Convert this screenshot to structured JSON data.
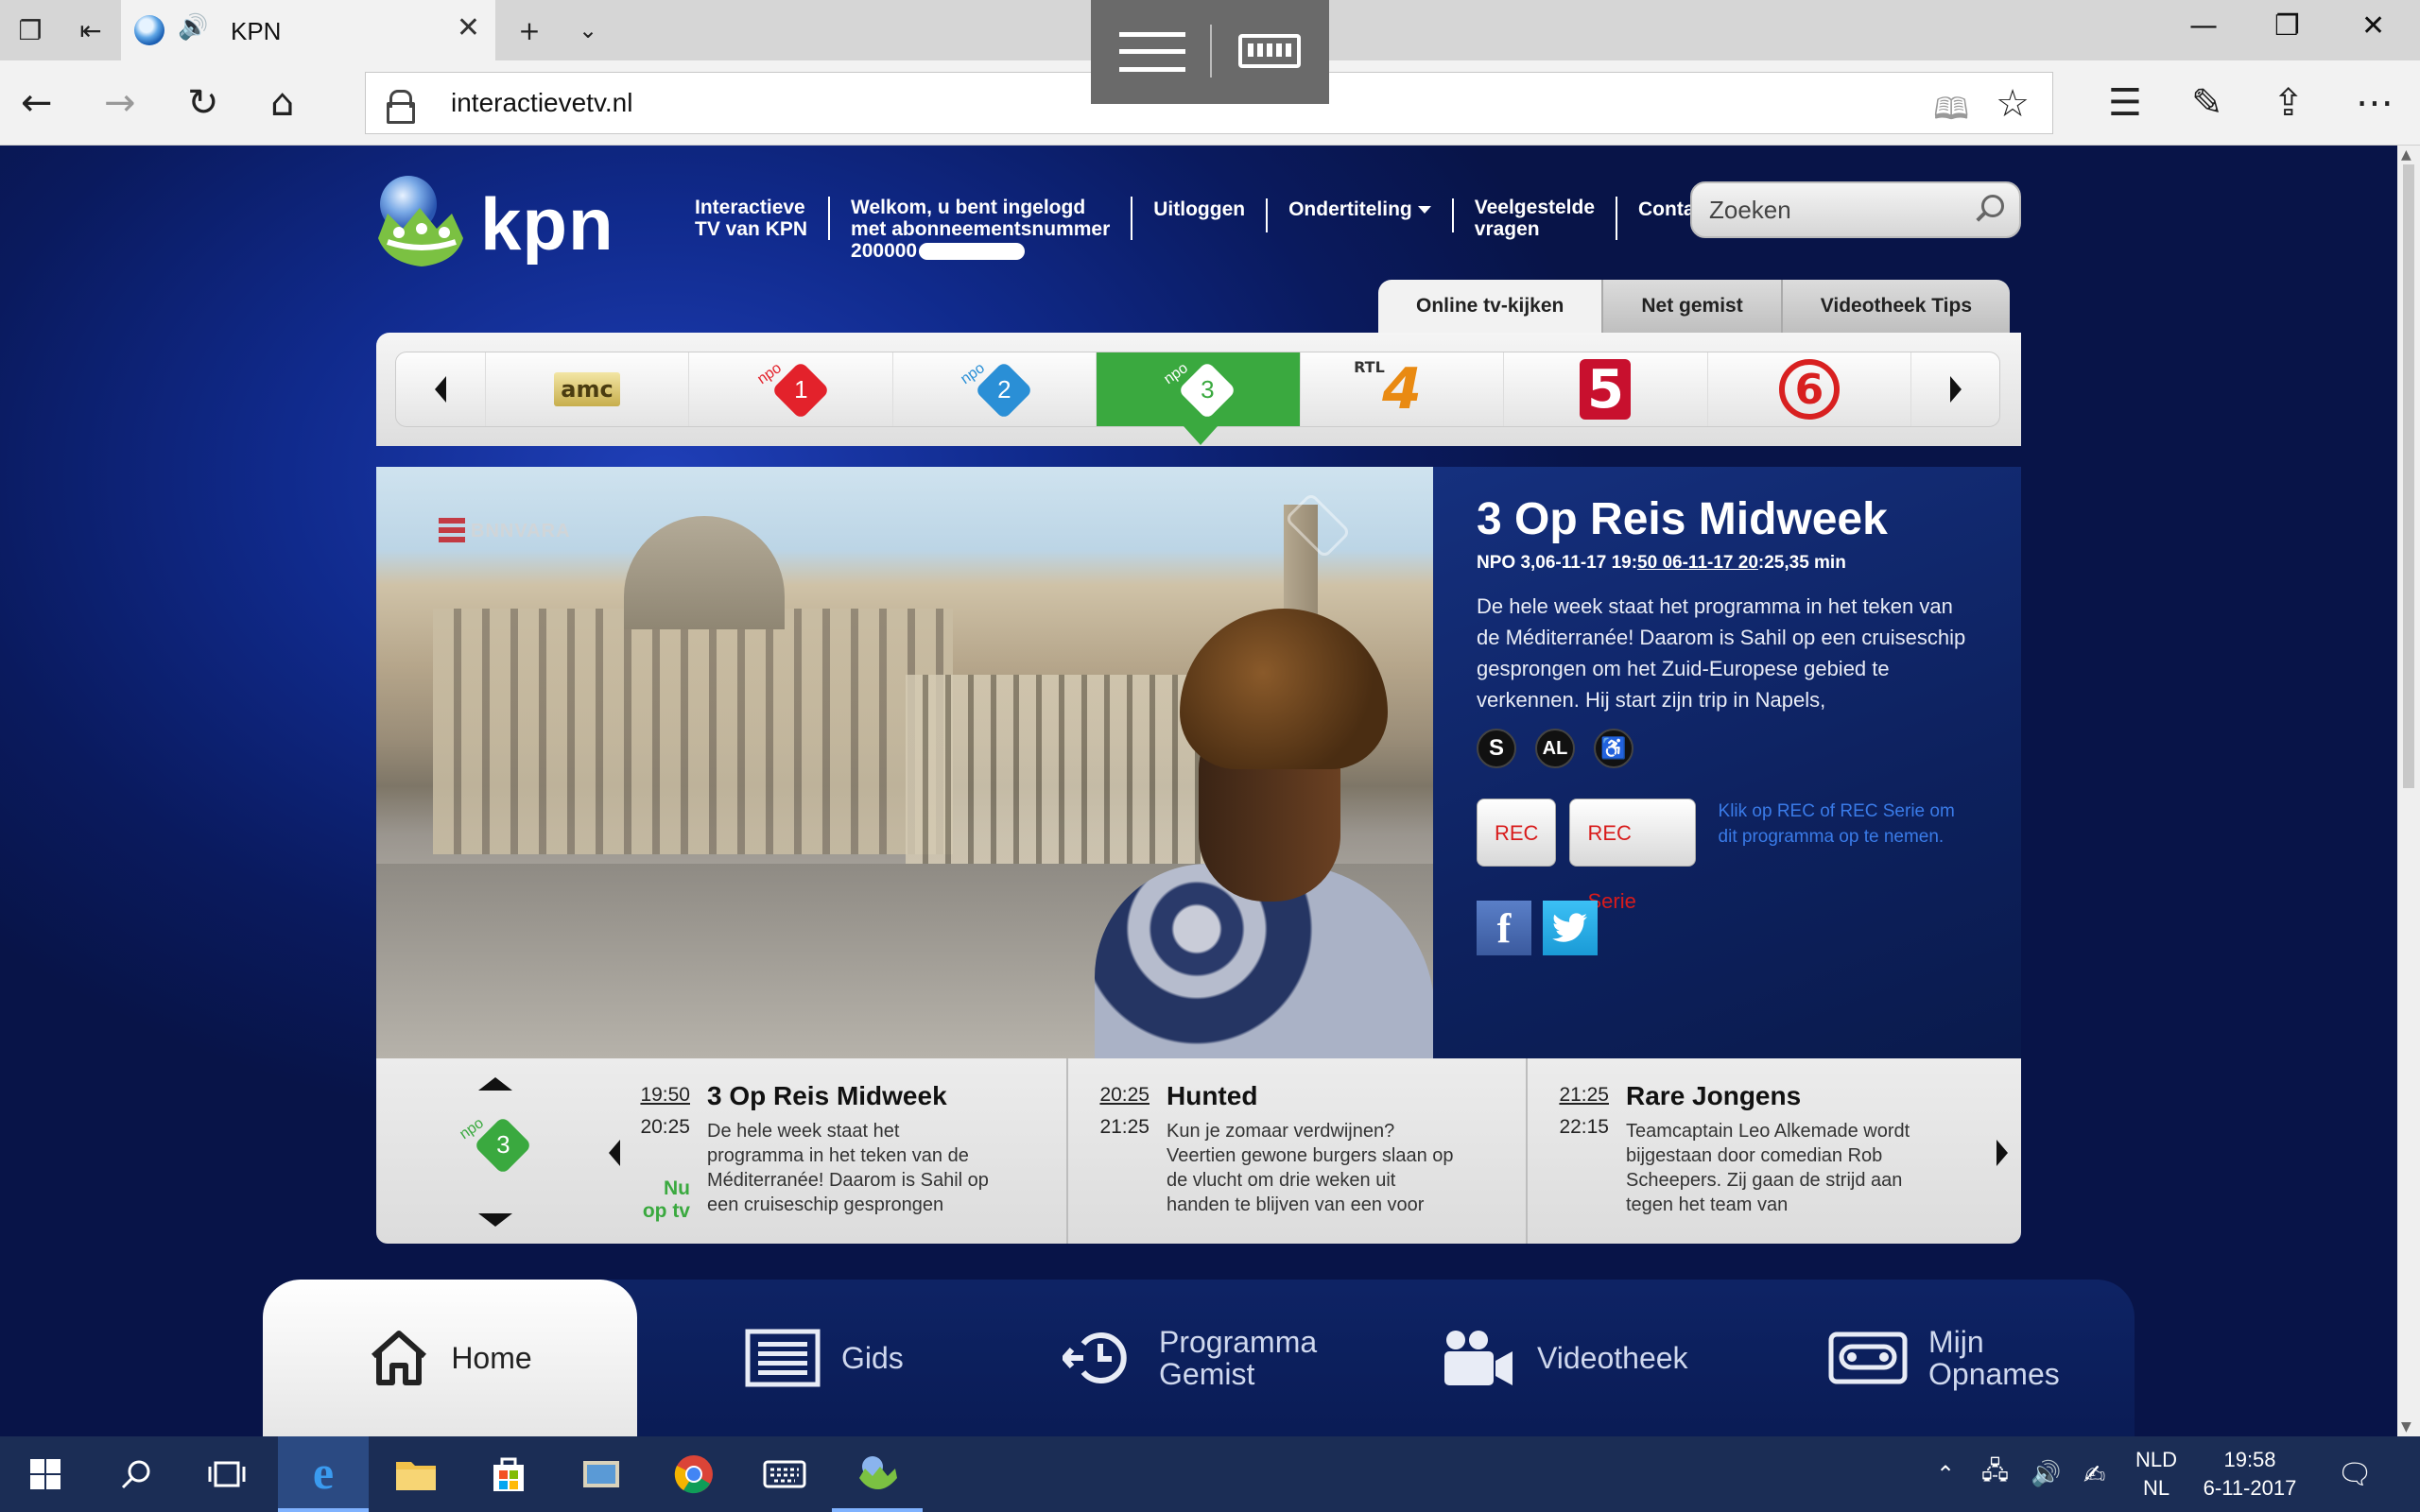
{
  "browser": {
    "tab_title": "KPN",
    "url": "interactievetv.nl"
  },
  "header": {
    "logo_text": "kpn",
    "nav": {
      "interactieve_line1": "Interactieve",
      "interactieve_line2": "TV van KPN",
      "welcome_line1": "Welkom, u bent ingelogd",
      "welcome_line2": "met abonneementsnummer",
      "welcome_number_prefix": "200000",
      "logout": "Uitloggen",
      "subtitles": "Ondertiteling",
      "faq_line1": "Veelgestelde",
      "faq_line2": "vragen",
      "contact": "Contact"
    },
    "search_placeholder": "Zoeken"
  },
  "tabs": [
    "Online tv-kijken",
    "Net gemist",
    "Videotheek Tips"
  ],
  "channels": [
    {
      "name": "amc",
      "label": "amc"
    },
    {
      "name": "npo1",
      "label": "1",
      "color": "#e3222b"
    },
    {
      "name": "npo2",
      "label": "2",
      "color": "#2a8fd6"
    },
    {
      "name": "npo3",
      "label": "3",
      "color": "#3aa93f",
      "active": true
    },
    {
      "name": "rtl4",
      "label": "4",
      "small": "RTL"
    },
    {
      "name": "rtl5",
      "label": "5"
    },
    {
      "name": "sbs6",
      "label": "6"
    }
  ],
  "video": {
    "broadcaster": "BNNVARA"
  },
  "program": {
    "title": "3 Op Reis Midweek",
    "meta_prefix": "NPO 3,06-11-17 19:",
    "meta_link": "50 06-11-17 20",
    "meta_suffix": ":25,35 min",
    "description": "De hele week staat het programma in het teken van de Méditerranée! Daarom is Sahil op een cruiseschip gesprongen om het Zuid-Europese gebied te verkennen. Hij start zijn trip in Napels,",
    "badges": [
      "S",
      "AL",
      "♿"
    ],
    "rec_label": "REC",
    "rec_serie_label": "REC Serie",
    "rec_hint": "Klik op REC of REC Serie om dit programma op te nemen.",
    "facebook": "f",
    "twitter": "t"
  },
  "epg": [
    {
      "start": "19:50",
      "end": "20:25",
      "title": "3 Op Reis Midweek",
      "desc": "De hele week staat het programma in het teken van de Méditerranée! Daarom is Sahil op een cruiseschip gesprongen",
      "now_line1": "Nu",
      "now_line2": "op tv"
    },
    {
      "start": "20:25",
      "end": "21:25",
      "title": "Hunted",
      "desc": "Kun je zomaar verdwijnen? Veertien gewone burgers slaan op de vlucht om drie weken uit handen te blijven van een voor"
    },
    {
      "start": "21:25",
      "end": "22:15",
      "title": "Rare Jongens",
      "desc": "Teamcaptain Leo Alkemade wordt bijgestaan door comedian Rob Scheepers. Zij gaan de strijd aan tegen het team van"
    }
  ],
  "bottom_menu": [
    {
      "label": "Home",
      "icon": "home-icon"
    },
    {
      "label": "Gids",
      "icon": "guide-icon"
    },
    {
      "label_line1": "Programma",
      "label_line2": "Gemist",
      "icon": "history-icon"
    },
    {
      "label": "Videotheek",
      "icon": "camera-icon"
    },
    {
      "label_line1": "Mijn",
      "label_line2": "Opnames",
      "icon": "cassette-icon"
    }
  ],
  "taskbar": {
    "lang_line1": "NLD",
    "lang_line2": "NL",
    "time": "19:58",
    "date": "6-11-2017"
  },
  "colors": {
    "page_bg": "#0b1a5c",
    "accent_green": "#3aa93f",
    "rec_red": "#d81b1b",
    "hint_blue": "#3a7be8"
  }
}
